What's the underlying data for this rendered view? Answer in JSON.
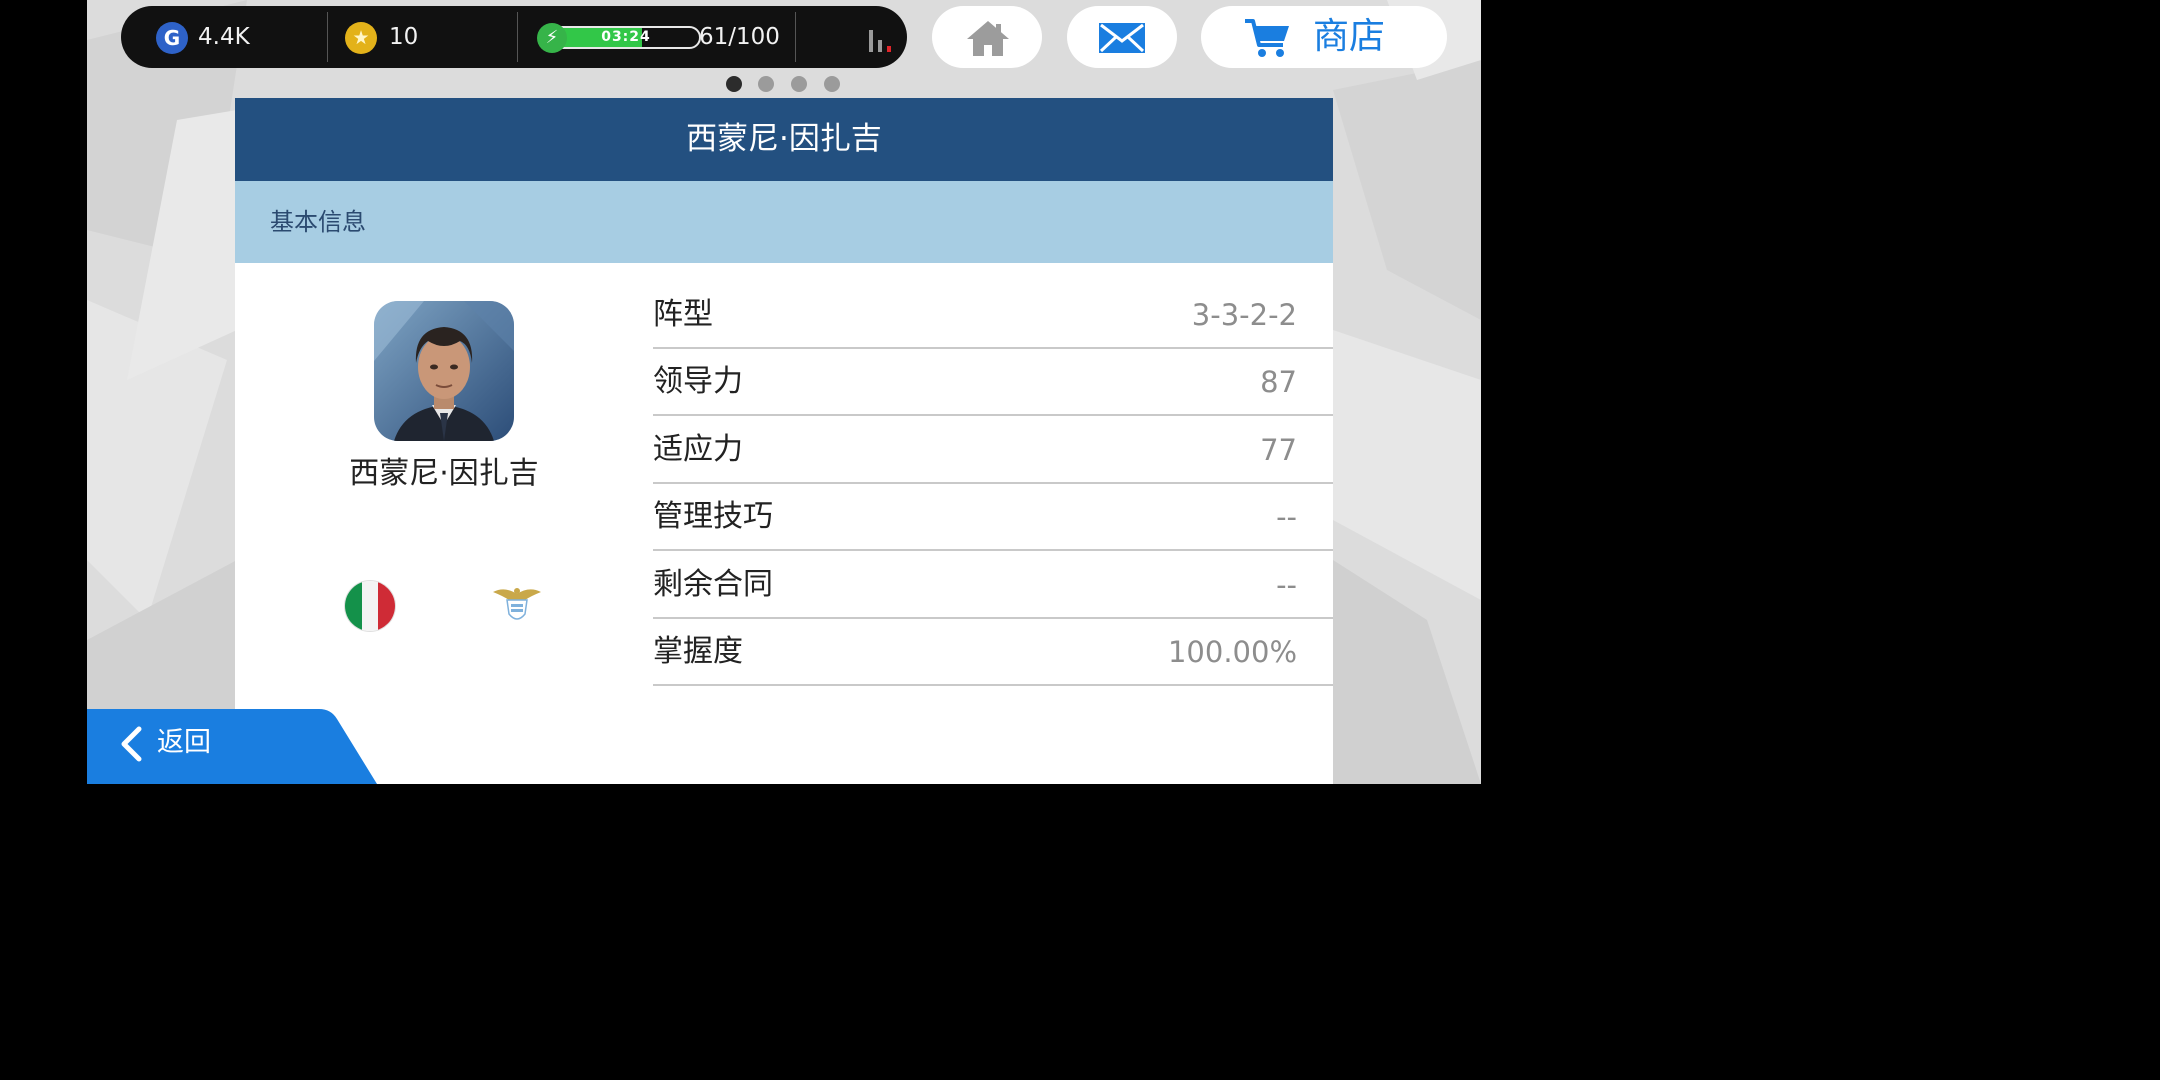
{
  "status_bar": {
    "gp_icon": "G",
    "gp_value": "4.4K",
    "coin_icon": "★",
    "coin_value": "10",
    "energy_icon": "⚡",
    "energy_timer": "03:24",
    "energy_fill": 0.61,
    "energy_value": "61/100",
    "signal_icon": "signal-bars-icon"
  },
  "nav": {
    "home_icon": "home-icon",
    "mail_icon": "mail-icon",
    "shop_icon": "cart-icon",
    "shop_label": "商店"
  },
  "pager": {
    "count": 4,
    "active": 0
  },
  "panel": {
    "title": "西蒙尼·因扎吉",
    "section_title": "基本信息",
    "coach_name": "西蒙尼·因扎吉",
    "flag_icon": "italy-flag-icon",
    "club_icon": "lazio-eagle-icon",
    "stats": [
      {
        "label": "阵型",
        "value": "3-3-2-2"
      },
      {
        "label": "领导力",
        "value": "87"
      },
      {
        "label": "适应力",
        "value": "77"
      },
      {
        "label": "管理技巧",
        "value": "--"
      },
      {
        "label": "剩余合同",
        "value": "--"
      },
      {
        "label": "掌握度",
        "value": "100.00%"
      }
    ]
  },
  "back": {
    "label": "返回"
  },
  "colors": {
    "header_blue": "#235080",
    "section_blue": "#a7cde3",
    "accent_blue": "#1a7ee0",
    "back_blue": "#1a7ee0",
    "energy_green": "#32c748"
  }
}
